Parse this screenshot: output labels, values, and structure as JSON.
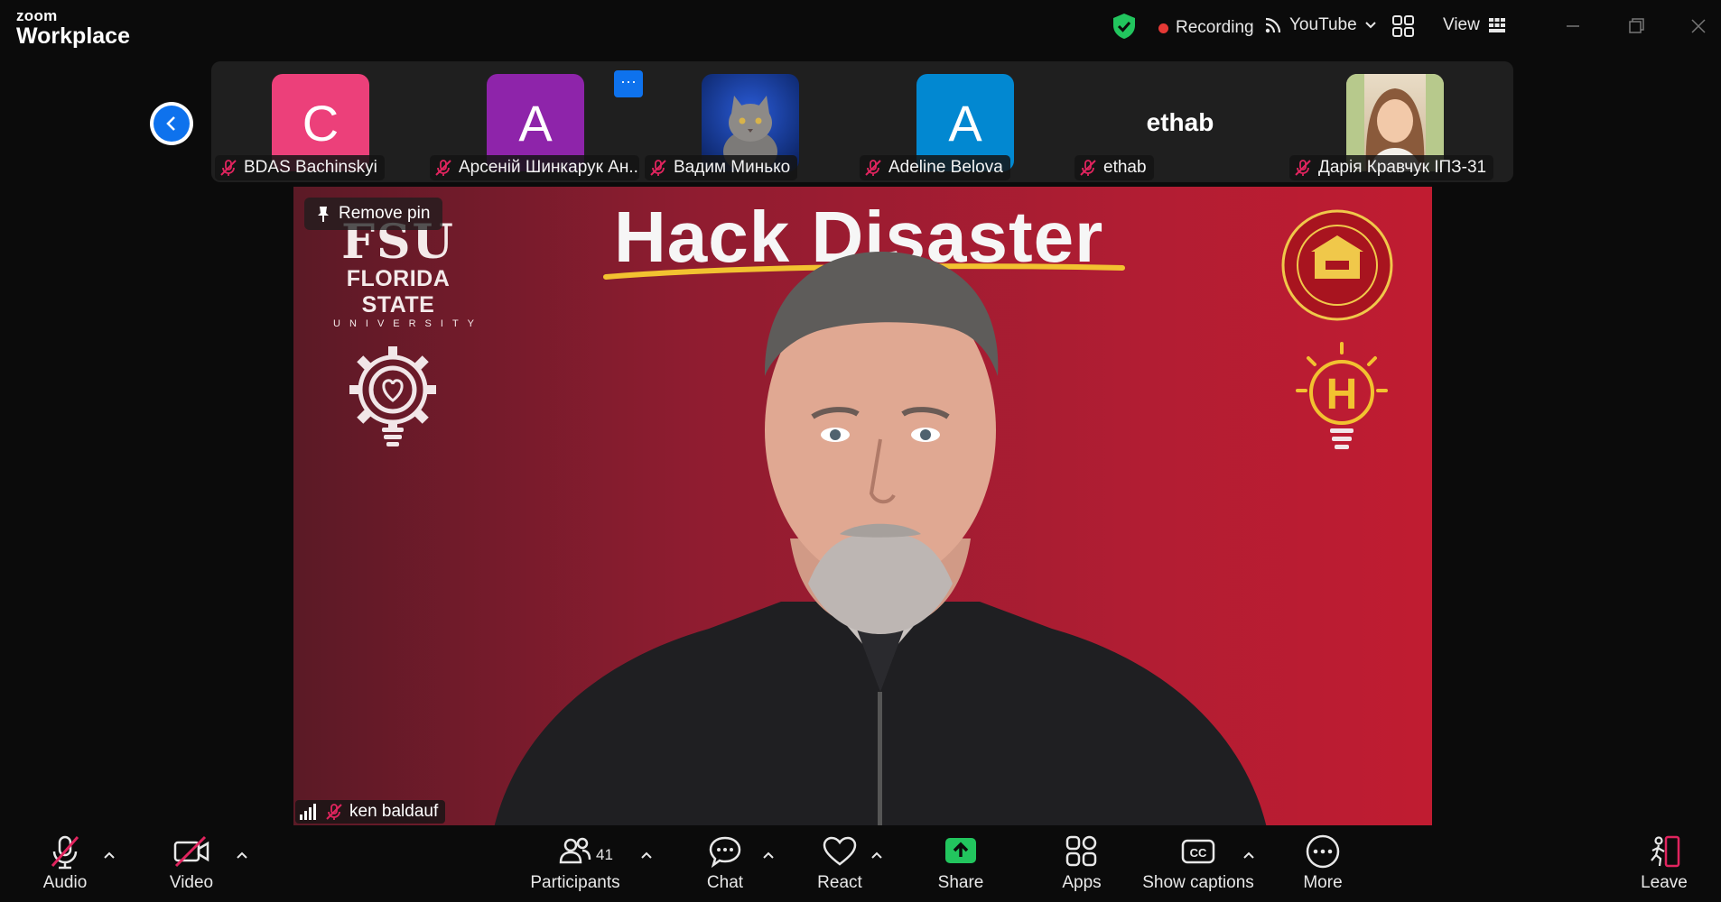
{
  "app": {
    "logo_top": "zoom",
    "logo_bottom": "Workplace"
  },
  "titlebar": {
    "recording_label": "Recording",
    "stream_label": "YouTube",
    "view_label": "View"
  },
  "participants_strip": [
    {
      "name": "BDAS Bachinskyi",
      "initial": "C",
      "color": "#ec407a"
    },
    {
      "name": "Арсеній Шинкарук Ан...",
      "initial": "A",
      "color": "#8e24aa"
    },
    {
      "name": "Вадим Минько",
      "initial": "",
      "color": "#1b3a8c"
    },
    {
      "name": "Adeline Belova",
      "initial": "A",
      "color": "#0288d1"
    },
    {
      "name": "ethab",
      "initial": "ethab",
      "color": "transparent"
    },
    {
      "name": "Дарія Кравчук ІПЗ-31",
      "initial": "",
      "color": "#d9c3a9"
    }
  ],
  "strip_more_label": "···",
  "main_video": {
    "pin_label": "Remove pin",
    "speaker_name": "ken baldauf",
    "slide_title": "Hack Disaster",
    "fsu_big": "FSU",
    "fsu_mid": "FLORIDA STATE",
    "fsu_small": "UNIVERSITY"
  },
  "toolbar": {
    "audio": "Audio",
    "video": "Video",
    "participants": "Participants",
    "participants_count": "41",
    "chat": "Chat",
    "react": "React",
    "share": "Share",
    "apps": "Apps",
    "captions": "Show captions",
    "more": "More",
    "leave": "Leave"
  },
  "colors": {
    "accent": "#0e72ed",
    "share": "#22c55e",
    "muted": "#e0245e",
    "recording": "#e53935"
  }
}
